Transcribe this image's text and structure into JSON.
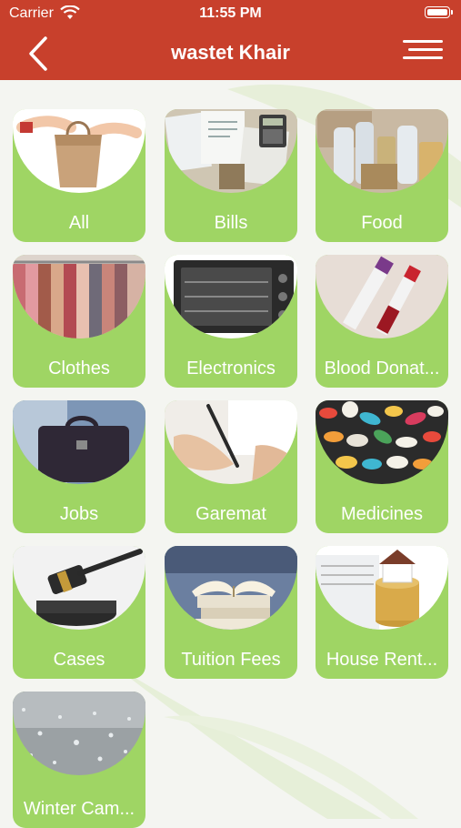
{
  "status_bar": {
    "carrier": "Carrier",
    "time": "11:55 PM"
  },
  "navbar": {
    "title": "wastet Khair",
    "back_icon": "chevron-left-icon",
    "menu_icon": "hamburger-menu-icon"
  },
  "colors": {
    "header": "#c8402c",
    "card": "#9fd564",
    "background": "#f4f5f1"
  },
  "categories": [
    {
      "label": "All"
    },
    {
      "label": "Bills"
    },
    {
      "label": "Food"
    },
    {
      "label": "Clothes"
    },
    {
      "label": "Electronics"
    },
    {
      "label": "Blood Donat..."
    },
    {
      "label": "Jobs"
    },
    {
      "label": "Garemat"
    },
    {
      "label": "Medicines"
    },
    {
      "label": "Cases"
    },
    {
      "label": "Tuition Fees"
    },
    {
      "label": "House Rent..."
    },
    {
      "label": "Winter Cam..."
    }
  ]
}
